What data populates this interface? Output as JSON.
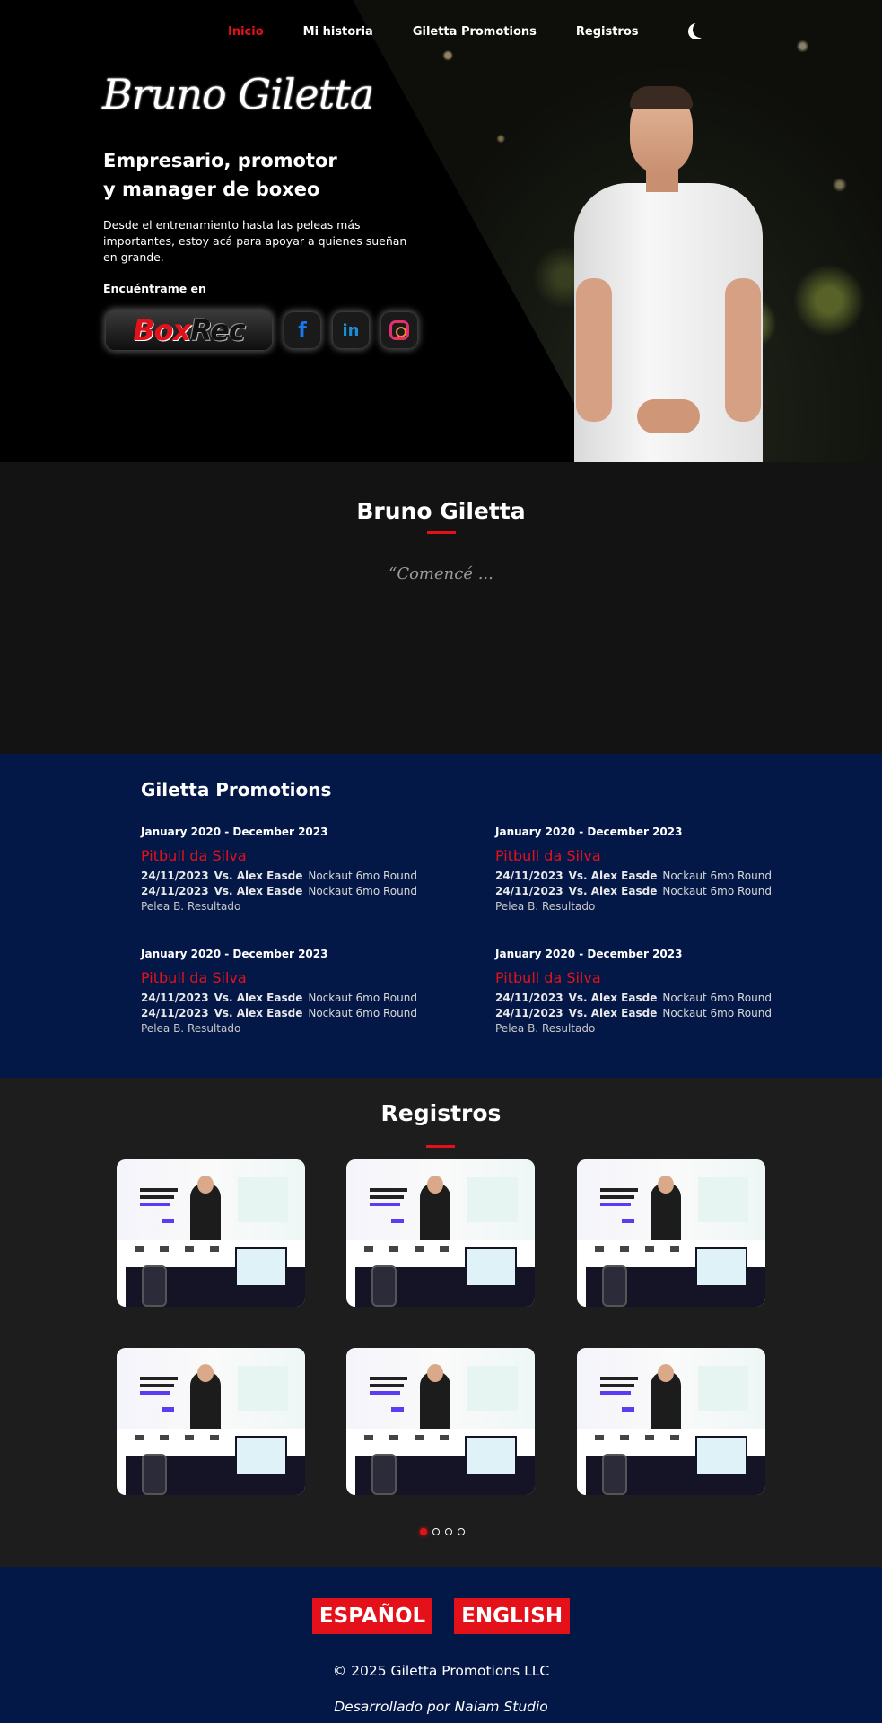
{
  "nav": {
    "items": [
      {
        "label": "Inicio",
        "active": true
      },
      {
        "label": "Mi historia",
        "active": false
      },
      {
        "label": "Giletta Promotions",
        "active": false
      },
      {
        "label": "Registros",
        "active": false
      }
    ],
    "theme_icon": "moon-icon"
  },
  "hero": {
    "signature": "Bruno Giletta",
    "title_line1": "Empresario, promotor",
    "title_line2": "y manager de boxeo",
    "description": "Desde el entrenamiento hasta las peleas más importantes, estoy acá para apoyar a quienes sueñan en grande.",
    "find_me": "Encuéntrame en",
    "socials": [
      {
        "name": "BoxRec",
        "part1": "Box",
        "part2": "Rec",
        "icon": "boxrec-logo"
      },
      {
        "name": "Facebook",
        "glyph": "f",
        "icon": "facebook-icon"
      },
      {
        "name": "LinkedIn",
        "glyph": "in",
        "icon": "linkedin-icon"
      },
      {
        "name": "Instagram",
        "icon": "instagram-icon"
      }
    ]
  },
  "bio": {
    "title": "Bruno Giletta",
    "quote": "“Comencé ..."
  },
  "promotions": {
    "title": "Giletta Promotions",
    "cards": [
      {
        "dates": "January 2020 - December 2023",
        "fighter": "Pitbull da Silva",
        "fights": [
          {
            "date": "24/11/2023",
            "opponent": "Vs. Alex Easde",
            "result": "Nockaut 6mo Round"
          },
          {
            "date": "24/11/2023",
            "opponent": "Vs. Alex Easde",
            "result": "Nockaut 6mo Round"
          }
        ],
        "summary": "Pelea B. Resultado"
      },
      {
        "dates": "January 2020 - December 2023",
        "fighter": "Pitbull da Silva",
        "fights": [
          {
            "date": "24/11/2023",
            "opponent": "Vs. Alex Easde",
            "result": "Nockaut 6mo Round"
          },
          {
            "date": "24/11/2023",
            "opponent": "Vs. Alex Easde",
            "result": "Nockaut 6mo Round"
          }
        ],
        "summary": "Pelea B. Resultado"
      },
      {
        "dates": "January 2020 - December 2023",
        "fighter": "Pitbull da Silva",
        "fights": [
          {
            "date": "24/11/2023",
            "opponent": "Vs. Alex Easde",
            "result": "Nockaut 6mo Round"
          },
          {
            "date": "24/11/2023",
            "opponent": "Vs. Alex Easde",
            "result": "Nockaut 6mo Round"
          }
        ],
        "summary": "Pelea B. Resultado"
      },
      {
        "dates": "January 2020 - December 2023",
        "fighter": "Pitbull da Silva",
        "fights": [
          {
            "date": "24/11/2023",
            "opponent": "Vs. Alex Easde",
            "result": "Nockaut 6mo Round"
          },
          {
            "date": "24/11/2023",
            "opponent": "Vs. Alex Easde",
            "result": "Nockaut 6mo Round"
          }
        ],
        "summary": "Pelea B. Resultado"
      }
    ]
  },
  "records": {
    "title": "Registros",
    "thumbnail_count": 6,
    "carousel": {
      "pages": 4,
      "active_page": 1
    }
  },
  "footer": {
    "lang_es": "ESPAÑOL",
    "lang_en": "ENGLISH",
    "copyright": "© 2025 Giletta Promotions LLC",
    "developed_by": "Desarrollado por Naiam Studio"
  },
  "colors": {
    "accent": "#e5111a",
    "navy": "#041847",
    "dark": "#131313",
    "section_dark": "#1d1d1d"
  }
}
